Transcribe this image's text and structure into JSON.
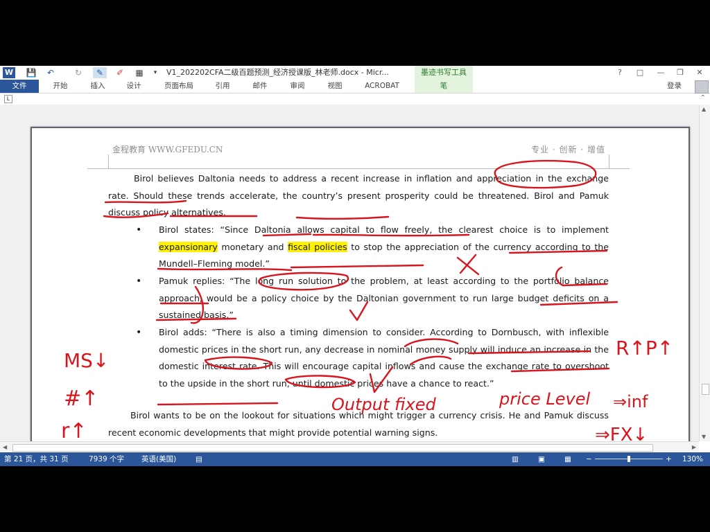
{
  "window": {
    "title": "V1_202202CFA二级百题预测_经济授课版_林老师.docx - Micr...",
    "context_tool": "墨迹书写工具",
    "help": "?",
    "window_controls": [
      "□",
      "—",
      "❐",
      "✕"
    ]
  },
  "quick_access": [
    "W",
    "💾",
    "↶",
    "↻",
    "✎",
    "✐",
    "▦",
    "▾"
  ],
  "tabs": {
    "file": "文件",
    "home": "开始",
    "insert": "插入",
    "design": "设计",
    "layout": "页面布局",
    "references": "引用",
    "mailings": "邮件",
    "review": "审阅",
    "view": "视图",
    "acrobat": "ACROBAT",
    "pen": "笔",
    "signin": "登录"
  },
  "ruler_button": "L",
  "page_header": {
    "left": "金程教育 WWW.GFEDU.CN",
    "right": "专业 · 创新 · 增值"
  },
  "document": {
    "para1": {
      "t1": "Birol believes Daltonia needs to address a recent increase in inflation and ",
      "t2": "appreciation in the exchange rate",
      "t3": ". Should these trends accelerate, the country’s present prosperity could be threatened. Birol and Pamuk discuss policy alternatives."
    },
    "bullet_symbol": "•",
    "bullet1": {
      "t1": "Birol states: “Since Daltonia allows capital to flow freely, the clearest choice is to implement ",
      "highlight1": "expansionary",
      "t2": " monetary and ",
      "highlight2": "fiscal policies",
      "t3": " to stop the appreciation of the currency according to the Mundell–Fleming model.”"
    },
    "bullet2": {
      "text": "Pamuk replies: “The long run solution to the problem, at least according to the portfolio balance approach, would be a policy choice by the Daltonian government to run large budget deficits on a sustained basis.”"
    },
    "bullet3": {
      "text": "Birol adds: “There is also a timing dimension to consider. According to Dornbusch, with inflexible domestic prices in the short run, any decrease in nominal money supply will induce an increase in the domestic interest rate. This will encourage capital inflows and cause the exchange rate to overshoot to the upside in the short run, until domestic prices have a chance to react.”"
    },
    "para2": {
      "text": "Birol wants to be on the lookout for situations which might trigger a currency crisis. He and Pamuk discuss recent economic developments that might provide potential warning signs."
    },
    "highlight_color": "#fff200"
  },
  "annotations": {
    "ink_color": "#d8141d",
    "notes": [
      "MS↓",
      "#↑",
      "r↑",
      "Output fixed",
      "price Level",
      "⇒inf",
      "⇒FX↓",
      "R↑P↑"
    ]
  },
  "statusbar": {
    "page": "第 21 页，共 31 页",
    "words": "7939 个字",
    "language": "英语(美国)",
    "zoom": "130%",
    "zoom_minus": "−",
    "zoom_plus": "+"
  },
  "colors": {
    "brand": "#2b579a",
    "context_tab": "#e3f3de"
  }
}
